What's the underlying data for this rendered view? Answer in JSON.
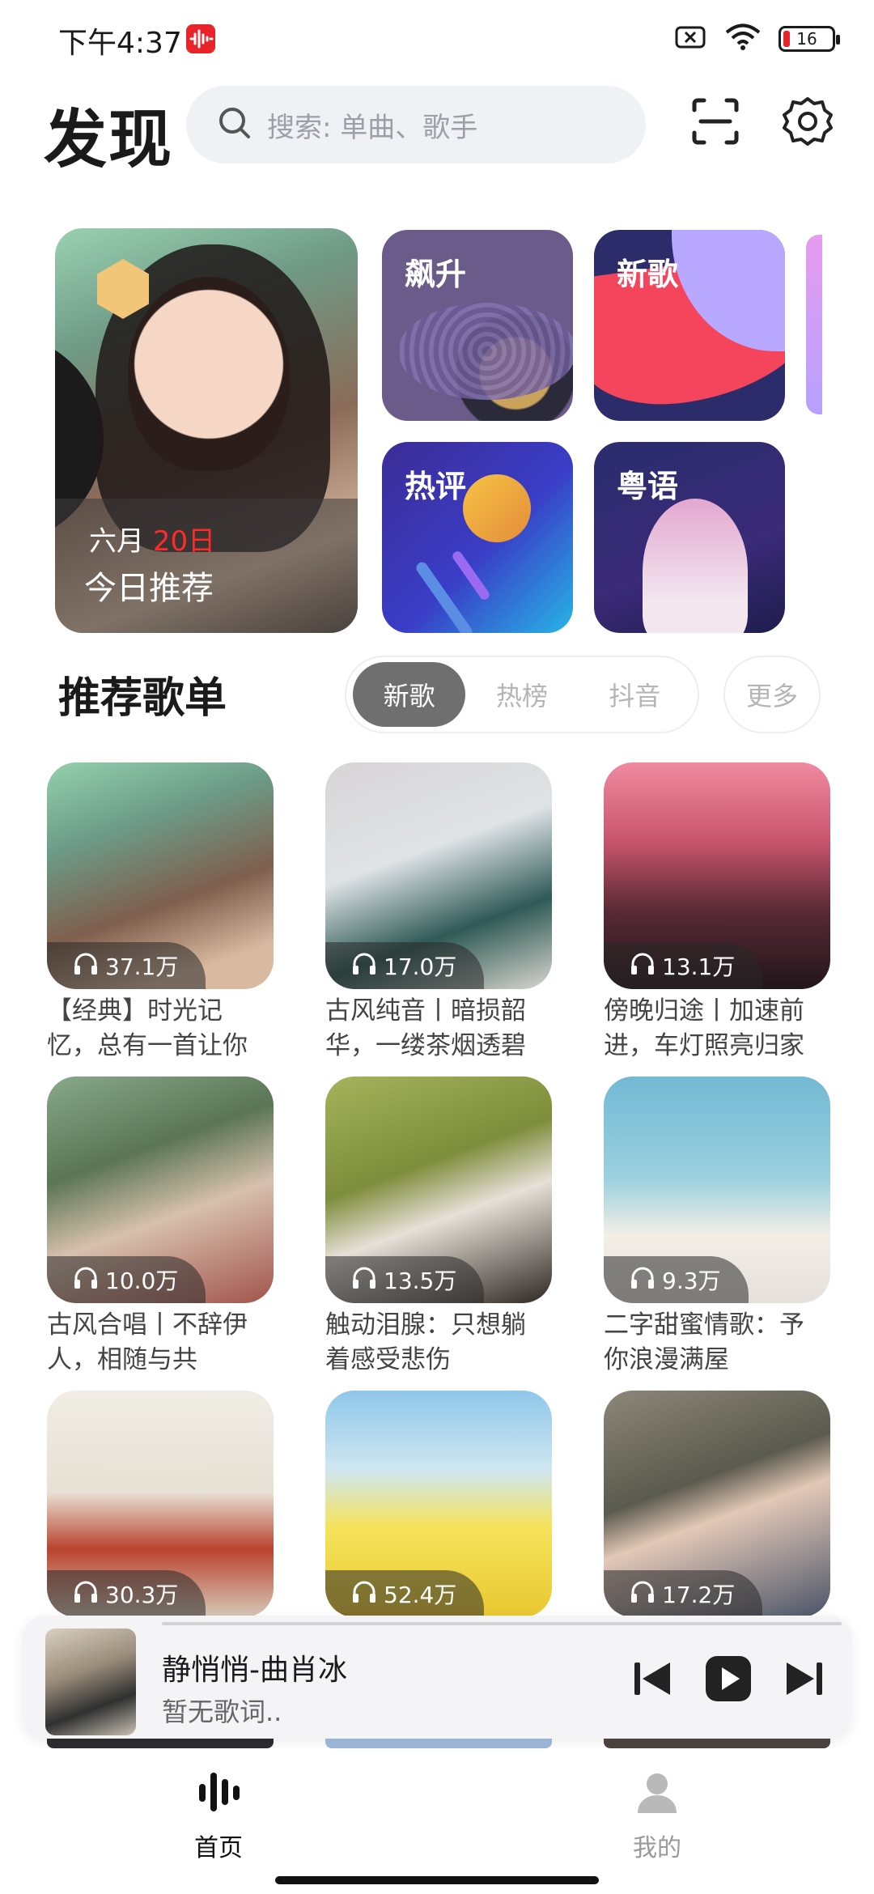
{
  "status_bar": {
    "time": "下午4:37",
    "battery": "16"
  },
  "header": {
    "title": "发现",
    "search_placeholder": "搜索: 单曲、歌手"
  },
  "featured": {
    "daily": {
      "month": "六月",
      "day": "20日",
      "label": "今日推荐"
    },
    "tiles": [
      "飙升",
      "新歌",
      "热评",
      "粤语"
    ]
  },
  "playlists_section": {
    "title": "推荐歌单",
    "tabs": [
      "新歌",
      "热榜",
      "抖音"
    ],
    "more": "更多",
    "items": [
      {
        "plays": "37.1万",
        "name": "【经典】时光记忆，总有一首让你"
      },
      {
        "plays": "17.0万",
        "name": "古风纯音丨暗损韶华，一缕茶烟透碧"
      },
      {
        "plays": "13.1万",
        "name": "傍晚归途丨加速前进，车灯照亮归家"
      },
      {
        "plays": "10.0万",
        "name": "古风合唱丨不辞伊人，相随与共"
      },
      {
        "plays": "13.5万",
        "name": "触动泪腺：只想躺着感受悲伤"
      },
      {
        "plays": "9.3万",
        "name": "二字甜蜜情歌：予你浪漫满屋"
      },
      {
        "plays": "30.3万",
        "name": ""
      },
      {
        "plays": "52.4万",
        "name": ""
      },
      {
        "plays": "17.2万",
        "name": ""
      }
    ]
  },
  "player": {
    "song": "静悄悄-曲肖冰",
    "lyric": "暂无歌词.."
  },
  "nav": {
    "home": "首页",
    "mine": "我的"
  }
}
